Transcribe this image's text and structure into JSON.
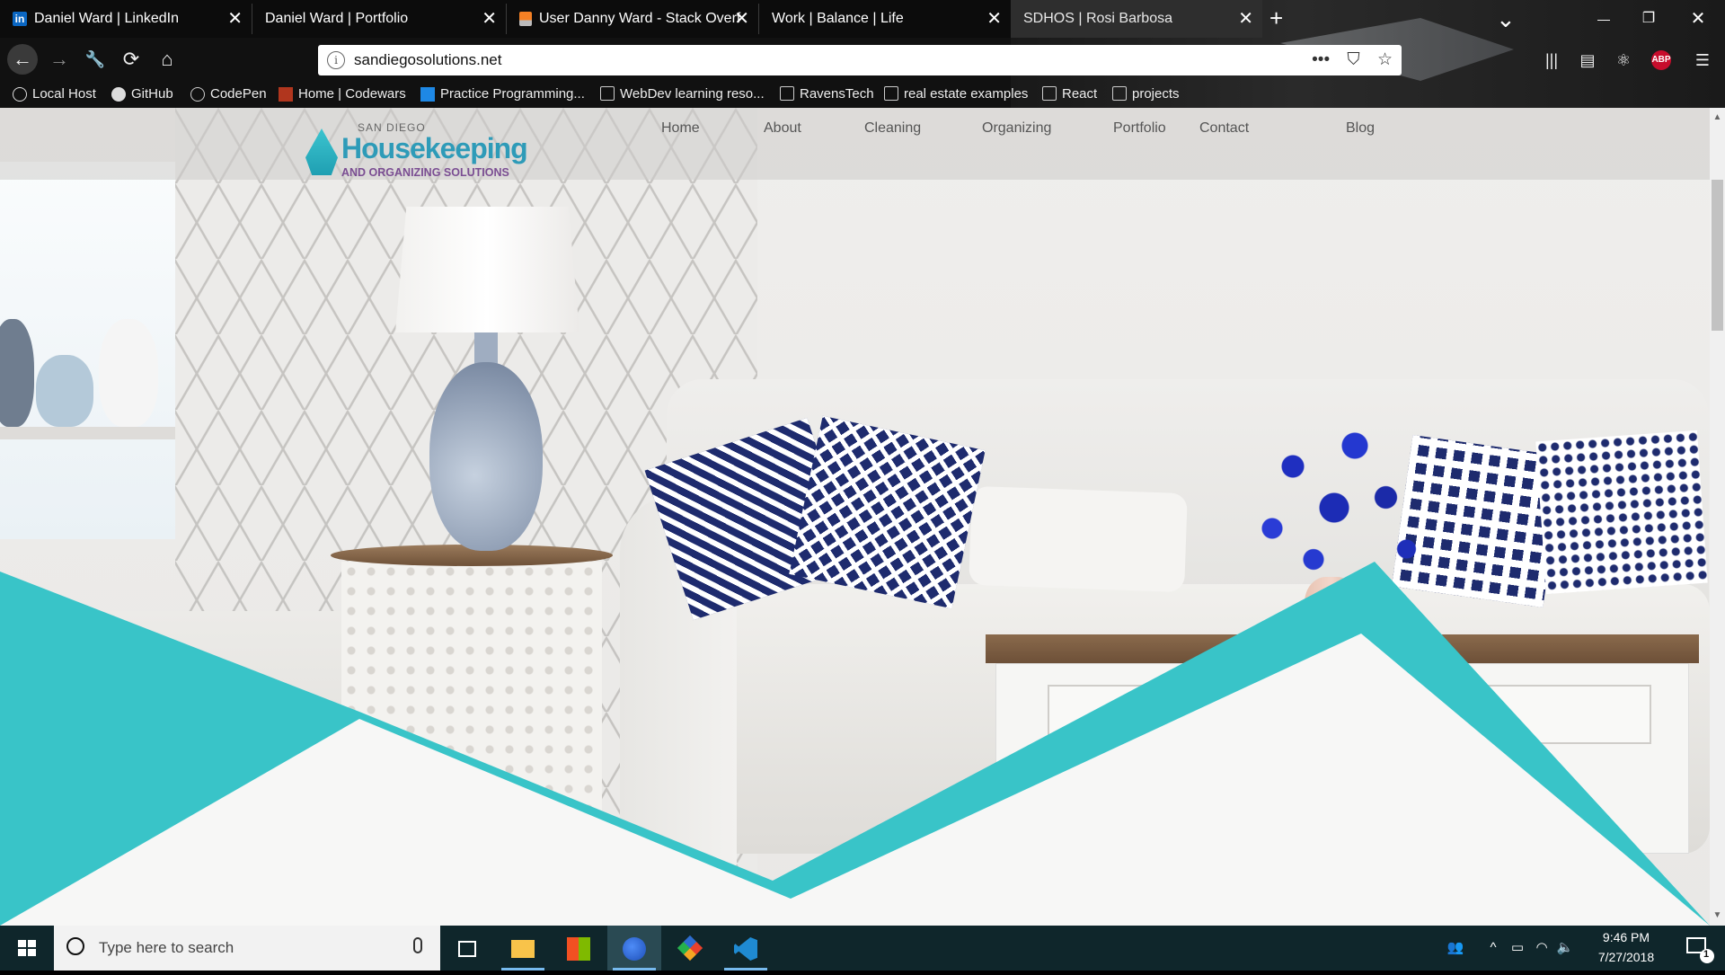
{
  "browser": {
    "tabs": [
      {
        "label": "Daniel Ward | LinkedIn",
        "icon": "linkedin-icon",
        "active": false
      },
      {
        "label": "Daniel Ward | Portfolio",
        "icon": "",
        "active": false
      },
      {
        "label": "User Danny Ward - Stack Overf",
        "icon": "stackoverflow-icon",
        "active": false
      },
      {
        "label": "Work | Balance | Life",
        "icon": "",
        "active": false
      },
      {
        "label": "SDHOS | Rosi Barbosa",
        "icon": "",
        "active": true
      }
    ],
    "new_tab_symbol": "+",
    "tab_list_symbol": "⌄",
    "window_controls": {
      "minimize": "—",
      "restore": "❐",
      "close": "✕"
    },
    "nav": {
      "back": "←",
      "forward": "→",
      "tools": "🔧",
      "reload": "⟳",
      "home": "⌂"
    },
    "url": "sandiegosolutions.net",
    "url_info_symbol": "i",
    "url_actions": {
      "more": "•••",
      "pocket": "⛉",
      "bookmark": "☆"
    },
    "toolbar_icons": [
      "library-icon",
      "sidebar-icon",
      "react-devtools-icon",
      "adblock-icon",
      "menu-icon"
    ],
    "abp_label": "ABP",
    "bookmarks": [
      {
        "label": "Local Host",
        "icon": "globe-icon"
      },
      {
        "label": "GitHub",
        "icon": "github-icon"
      },
      {
        "label": "CodePen",
        "icon": "codepen-icon"
      },
      {
        "label": "Home | Codewars",
        "icon": "codewars-icon"
      },
      {
        "label": "Practice Programming...",
        "icon": "bookmark-site-icon"
      },
      {
        "label": "WebDev learning reso...",
        "icon": "folder-icon"
      },
      {
        "label": "RavensTech",
        "icon": "folder-icon"
      },
      {
        "label": "real estate examples",
        "icon": "folder-icon"
      },
      {
        "label": "React",
        "icon": "folder-icon"
      },
      {
        "label": "projects",
        "icon": "folder-icon"
      }
    ]
  },
  "site": {
    "logo": {
      "top": "SAN DIEGO",
      "main": "Housekeeping",
      "sub": "AND ORGANIZING SOLUTIONS"
    },
    "nav": [
      "Home",
      "About",
      "Cleaning",
      "Organizing",
      "Portfolio",
      "Contact",
      "Blog"
    ],
    "accent_color": "#39c4c8"
  },
  "taskbar": {
    "search_placeholder": "Type here to search",
    "apps": [
      "task-view-icon",
      "file-explorer-icon",
      "store-icon",
      "firefox-icon",
      "git-kraken-icon",
      "vscode-icon"
    ],
    "time": "9:46 PM",
    "date": "7/27/2018",
    "notification_count": "1"
  }
}
